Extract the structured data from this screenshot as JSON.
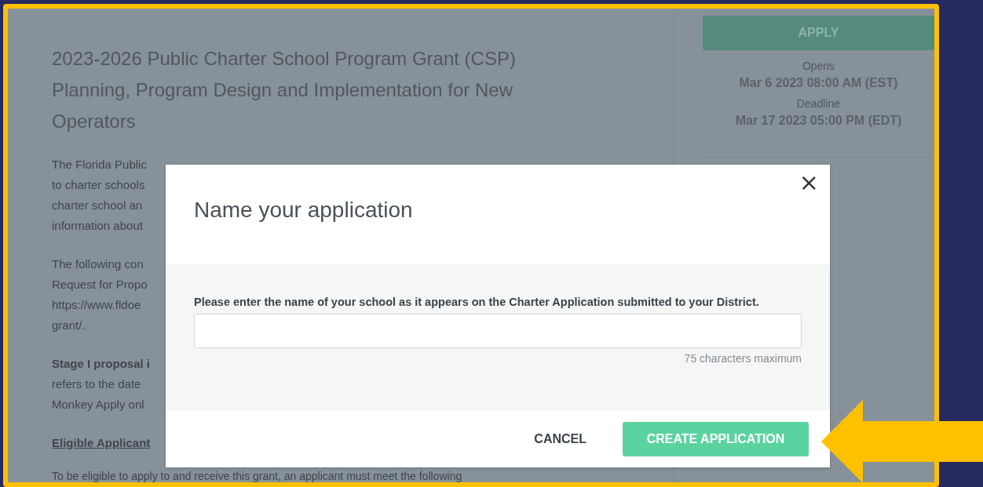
{
  "page": {
    "title": "2023-2026 Public Charter School Program Grant (CSP) Planning, Program Design and Implementation for New Operators",
    "paragraphs": [
      {
        "kind": "plain",
        "lines": [
          "The Florida Public",
          "to charter schools",
          "charter school an",
          "information about"
        ]
      },
      {
        "kind": "plain",
        "lines": [
          "The following con",
          "Request for Propo",
          "https://www.fldoe",
          "grant/."
        ]
      },
      {
        "kind": "mixed",
        "lines": [
          "**Stage I proposal i**",
          "refers to the date",
          "Monkey Apply onl"
        ]
      },
      {
        "kind": "heading",
        "lines": [
          "Eligible Applicant"
        ]
      },
      {
        "kind": "plain",
        "lines": [
          "To be eligible to apply to and receive this grant, an applicant must meet the following"
        ]
      }
    ]
  },
  "sidebar": {
    "apply_button": "APPLY",
    "dates": [
      {
        "label": "Opens",
        "value": "Mar 6 2023 08:00 AM (EST)"
      },
      {
        "label": "Deadline",
        "value": "Mar 17 2023 05:00 PM (EDT)"
      }
    ]
  },
  "dialog": {
    "title": "Name your application",
    "close": "×",
    "field_label": "Please enter the name of your school as it appears on the Charter Application submitted to your District.",
    "hint": "75 characters maximum",
    "cancel": "CANCEL",
    "submit": "CREATE APPLICATION"
  }
}
